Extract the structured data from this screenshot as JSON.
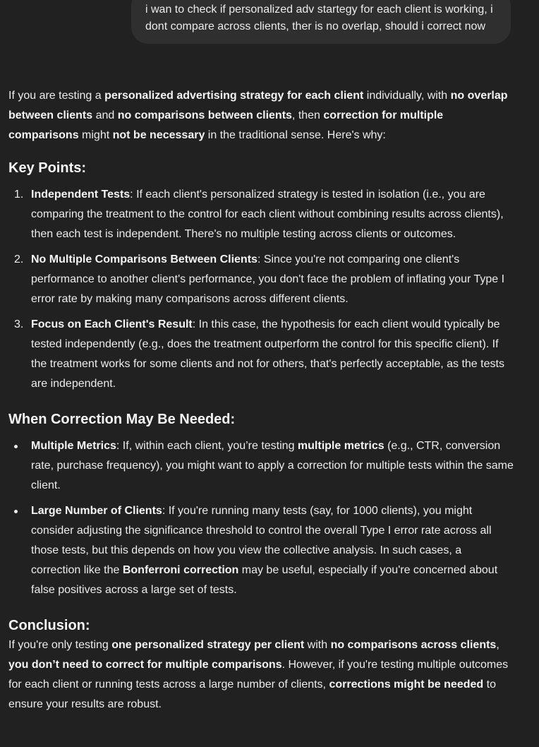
{
  "user_message": "i wan to check if personalized adv startegy for each client is working, i dont compare across clients, ther is no overlap, should i correct now",
  "intro": [
    {
      "t": "If you are testing a "
    },
    {
      "t": "personalized advertising strategy for each client",
      "b": true
    },
    {
      "t": " individually, with "
    },
    {
      "t": "no overlap between clients",
      "b": true
    },
    {
      "t": " and "
    },
    {
      "t": "no comparisons between clients",
      "b": true
    },
    {
      "t": ", then "
    },
    {
      "t": "correction for multiple comparisons",
      "b": true
    },
    {
      "t": " might "
    },
    {
      "t": "not be necessary",
      "b": true
    },
    {
      "t": " in the traditional sense. Here's why:"
    }
  ],
  "key_points": {
    "heading": "Key Points:",
    "items": [
      {
        "marker": "1.",
        "segments": [
          {
            "t": "Independent Tests",
            "b": true
          },
          {
            "t": ": If each client's personalized strategy is tested in isolation (i.e., you are comparing the treatment to the control for each client without combining results across clients), then each test is independent. There's no multiple testing across clients or outcomes."
          }
        ]
      },
      {
        "marker": "2.",
        "segments": [
          {
            "t": "No Multiple Comparisons Between Clients",
            "b": true
          },
          {
            "t": ": Since you're not comparing one client's performance to another client's performance, you don't face the problem of inflating your Type I error rate by making many comparisons across different clients."
          }
        ]
      },
      {
        "marker": "3.",
        "segments": [
          {
            "t": "Focus on Each Client's Result",
            "b": true
          },
          {
            "t": ": In this case, the hypothesis for each client would typically be tested independently (e.g., does the treatment outperform the control for this specific client). If the treatment works for some clients and not for others, that's perfectly acceptable, as the tests are independent."
          }
        ]
      }
    ]
  },
  "when_needed": {
    "heading": "When Correction May Be Needed:",
    "items": [
      {
        "segments": [
          {
            "t": "Multiple Metrics",
            "b": true
          },
          {
            "t": ": If, within each client, you’re testing "
          },
          {
            "t": "multiple metrics",
            "b": true
          },
          {
            "t": " (e.g., CTR, conversion rate, purchase frequency), you might want to apply a correction for multiple tests within the same client."
          }
        ]
      },
      {
        "segments": [
          {
            "t": "Large Number of Clients",
            "b": true
          },
          {
            "t": ": If you're running many tests (say, for 1000 clients), you might consider adjusting the significance threshold to control the overall Type I error rate across all those tests, but this depends on how you view the collective analysis. In such cases, a correction like the "
          },
          {
            "t": "Bonferroni correction",
            "b": true
          },
          {
            "t": " may be useful, especially if you're concerned about false positives across a large set of tests."
          }
        ]
      }
    ]
  },
  "conclusion": {
    "heading": "Conclusion:",
    "segments": [
      {
        "t": "If you're only testing "
      },
      {
        "t": "one personalized strategy per client",
        "b": true
      },
      {
        "t": " with "
      },
      {
        "t": "no comparisons across clients",
        "b": true
      },
      {
        "t": ", "
      },
      {
        "t": "you don’t need to correct for multiple comparisons",
        "b": true
      },
      {
        "t": ". However, if you're testing multiple outcomes for each client or running tests across a large number of clients, "
      },
      {
        "t": "corrections might be needed",
        "b": true
      },
      {
        "t": " to ensure your results are robust."
      }
    ]
  }
}
